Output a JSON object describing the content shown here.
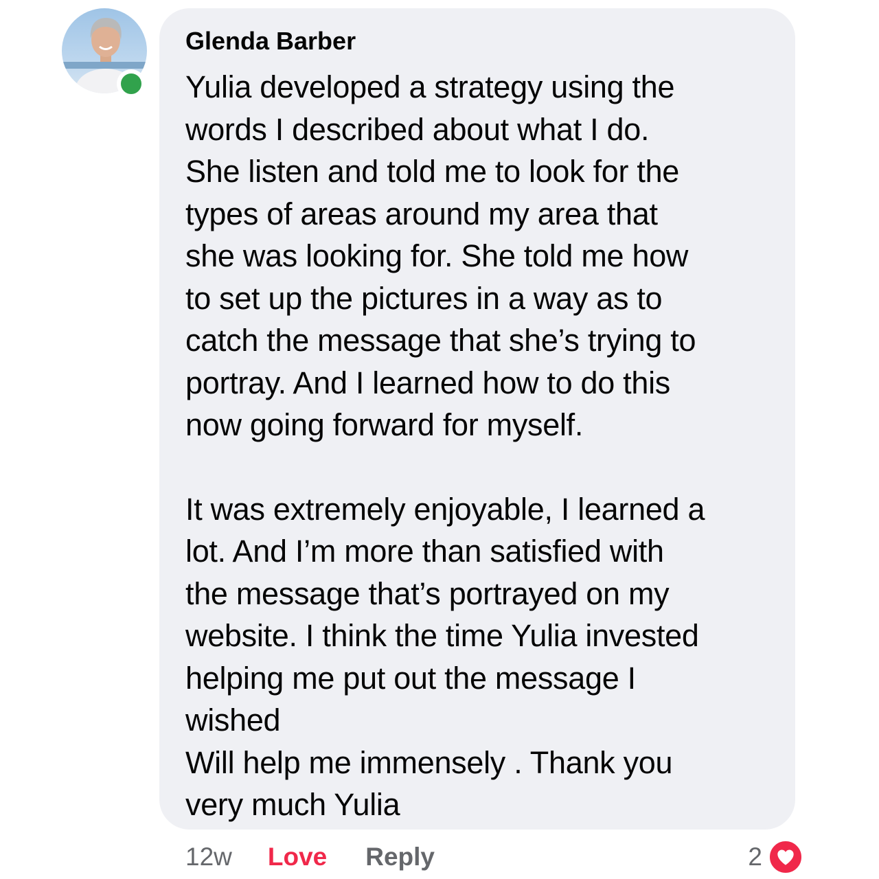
{
  "comment": {
    "author": "Glenda Barber",
    "online": true,
    "paragraphs": [
      "Yulia developed a strategy using the\nwords I described about what I do.\nShe listen and told me to look for the\ntypes of areas around my area that\nshe was looking for. She told me how\nto set up the pictures in a way as to\ncatch the message that she’s trying to\nportray. And I learned how to do this\nnow going forward for myself.",
      "It was extremely enjoyable, I learned a\nlot. And I’m more than satisfied with\nthe message that’s portrayed on my\nwebsite. I think the time Yulia invested\nhelping  me put out the message  I\nwished\nWill help me immensely . Thank you\nvery much Yulia"
    ]
  },
  "actions": {
    "time": "12w",
    "love_label": "Love",
    "reply_label": "Reply"
  },
  "reactions": {
    "count": "2",
    "type_icon": "heart-icon"
  },
  "colors": {
    "bubble_bg": "#eff0f4",
    "love_red": "#f0284a",
    "online_green": "#31a24c",
    "meta_gray": "#65676b"
  }
}
